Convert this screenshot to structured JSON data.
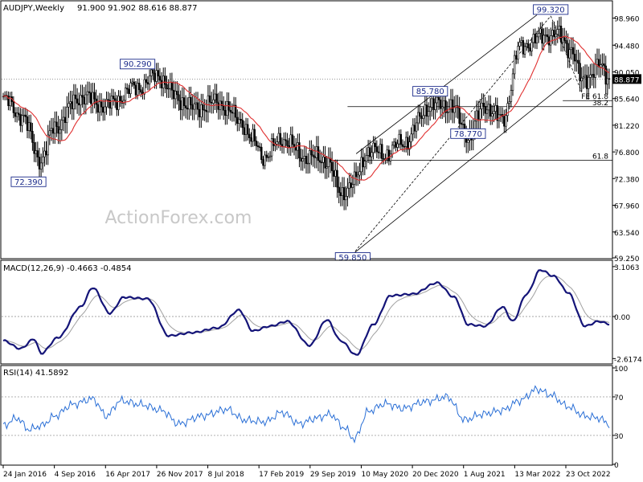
{
  "chart_data": [
    {
      "type": "candlestick",
      "title": "AUDJPY,Weekly",
      "ohlc_label": "91.900 91.902 88.616 88.877",
      "watermark": "ActionForex.com",
      "current_price": "88.877",
      "ylim": [
        59.25,
        101.7
      ],
      "y_ticks": [
        "98.960",
        "94.480",
        "90.050",
        "85.640",
        "81.220",
        "76.800",
        "72.380",
        "67.960",
        "63.540",
        "59.250"
      ],
      "x_ticks": [
        "24 Jan 2016",
        "4 Sep 2016",
        "16 Apr 2017",
        "26 Nov 2017",
        "8 Jul 2018",
        "17 Feb 2019",
        "29 Sep 2019",
        "10 May 2020",
        "20 Dec 2020",
        "1 Aug 2021",
        "13 Mar 2022",
        "23 Oct 2022"
      ],
      "anchors": [
        {
          "t": 0,
          "c": 85.5
        },
        {
          "t": 10,
          "c": 83.0
        },
        {
          "t": 22,
          "c": 75.5
        },
        {
          "t": 30,
          "c": 81.0
        },
        {
          "t": 45,
          "c": 86.0
        },
        {
          "t": 60,
          "c": 84.5
        },
        {
          "t": 78,
          "c": 87.5
        },
        {
          "t": 90,
          "c": 89.5
        },
        {
          "t": 100,
          "c": 86.0
        },
        {
          "t": 110,
          "c": 84.0
        },
        {
          "t": 125,
          "c": 85.0
        },
        {
          "t": 138,
          "c": 82.0
        },
        {
          "t": 145,
          "c": 78.5
        },
        {
          "t": 152,
          "c": 76.0
        },
        {
          "t": 162,
          "c": 79.0
        },
        {
          "t": 175,
          "c": 76.0
        },
        {
          "t": 188,
          "c": 75.5
        },
        {
          "t": 196,
          "c": 70.0
        },
        {
          "t": 203,
          "c": 71.5
        },
        {
          "t": 212,
          "c": 77.0
        },
        {
          "t": 222,
          "c": 76.5
        },
        {
          "t": 233,
          "c": 78.5
        },
        {
          "t": 248,
          "c": 84.5
        },
        {
          "t": 260,
          "c": 84.5
        },
        {
          "t": 270,
          "c": 79.5
        },
        {
          "t": 280,
          "c": 84.5
        },
        {
          "t": 290,
          "c": 82.0
        },
        {
          "t": 300,
          "c": 94.0
        },
        {
          "t": 310,
          "c": 95.5
        },
        {
          "t": 320,
          "c": 96.5
        },
        {
          "t": 330,
          "c": 94.0
        },
        {
          "t": 336,
          "c": 88.5
        },
        {
          "t": 346,
          "c": 91.0
        },
        {
          "t": 352,
          "c": 88.9
        }
      ],
      "swing_labels": [
        {
          "text": "90.290",
          "t": 78,
          "value": 90.29
        },
        {
          "text": "72.390",
          "t": 22,
          "value": 72.39
        },
        {
          "text": "59.850",
          "t": 203,
          "value": 59.85
        },
        {
          "text": "85.780",
          "t": 248,
          "value": 85.78
        },
        {
          "text": "78.770",
          "t": 270,
          "value": 78.77
        },
        {
          "text": "99.320",
          "t": 318,
          "value": 99.32
        }
      ],
      "levels": [
        {
          "label": "61.8",
          "value": 75.4,
          "t_start": 190
        },
        {
          "label": "38.2",
          "value": 84.3,
          "t_start": 200
        },
        {
          "label": "FE 61.8",
          "value": 85.3,
          "t_start": 325
        }
      ],
      "channel": {
        "upper": [
          {
            "t": 205,
            "v": 76.5
          },
          {
            "t": 310,
            "v": 99.5
          }
        ],
        "lower": [
          {
            "t": 203,
            "v": 59.85
          },
          {
            "t": 330,
            "v": 89.0
          }
        ],
        "dashed": [
          {
            "t": 203,
            "v": 59.85
          },
          {
            "t": 318,
            "v": 99.32
          }
        ],
        "pattern": [
          {
            "t": 318,
            "v": 99.32
          },
          {
            "t": 336,
            "v": 86.7
          }
        ]
      }
    },
    {
      "type": "line",
      "title": "MACD(12,26,9) -0.4663 -0.4854",
      "ylim": [
        -2.9,
        3.4
      ],
      "y_ticks": [
        {
          "label": "3.1063",
          "value": 3.1063
        },
        {
          "label": "0.00",
          "value": 0
        },
        {
          "label": "-2.6174",
          "value": -2.6174
        }
      ],
      "series": [
        {
          "values": [
            {
              "t": 0,
              "v": -1.5
            },
            {
              "t": 10,
              "v": -2.0
            },
            {
              "t": 18,
              "v": -1.4
            },
            {
              "t": 22,
              "v": -2.3
            },
            {
              "t": 32,
              "v": -1.3
            },
            {
              "t": 45,
              "v": 0.6
            },
            {
              "t": 52,
              "v": 1.8
            },
            {
              "t": 62,
              "v": 0.2
            },
            {
              "t": 70,
              "v": 1.2
            },
            {
              "t": 84,
              "v": 1.1
            },
            {
              "t": 96,
              "v": -1.2
            },
            {
              "t": 110,
              "v": -1.0
            },
            {
              "t": 125,
              "v": -0.7
            },
            {
              "t": 137,
              "v": 0.4
            },
            {
              "t": 145,
              "v": -0.9
            },
            {
              "t": 155,
              "v": -0.6
            },
            {
              "t": 165,
              "v": -0.3
            },
            {
              "t": 178,
              "v": -1.8
            },
            {
              "t": 188,
              "v": -0.2
            },
            {
              "t": 196,
              "v": -1.5
            },
            {
              "t": 205,
              "v": -2.4
            },
            {
              "t": 215,
              "v": -0.5
            },
            {
              "t": 225,
              "v": 1.3
            },
            {
              "t": 238,
              "v": 1.4
            },
            {
              "t": 252,
              "v": 2.1
            },
            {
              "t": 262,
              "v": 1.2
            },
            {
              "t": 270,
              "v": -0.5
            },
            {
              "t": 280,
              "v": -0.6
            },
            {
              "t": 290,
              "v": 0.6
            },
            {
              "t": 296,
              "v": -0.3
            },
            {
              "t": 304,
              "v": 1.4
            },
            {
              "t": 312,
              "v": 2.9
            },
            {
              "t": 320,
              "v": 2.5
            },
            {
              "t": 328,
              "v": 1.5
            },
            {
              "t": 338,
              "v": -0.6
            },
            {
              "t": 346,
              "v": -0.3
            },
            {
              "t": 352,
              "v": -0.47
            }
          ]
        }
      ]
    },
    {
      "type": "line",
      "title": "RSI(14) 41.5892",
      "ylim": [
        0,
        100
      ],
      "y_ticks": [
        {
          "label": "100",
          "value": 100
        },
        {
          "label": "70",
          "value": 70
        },
        {
          "label": "30",
          "value": 30
        },
        {
          "label": "0",
          "value": 0
        }
      ],
      "series": [
        {
          "values": [
            {
              "t": 0,
              "v": 40
            },
            {
              "t": 8,
              "v": 48
            },
            {
              "t": 15,
              "v": 36
            },
            {
              "t": 22,
              "v": 40
            },
            {
              "t": 30,
              "v": 50
            },
            {
              "t": 40,
              "v": 62
            },
            {
              "t": 52,
              "v": 68
            },
            {
              "t": 60,
              "v": 50
            },
            {
              "t": 68,
              "v": 66
            },
            {
              "t": 80,
              "v": 62
            },
            {
              "t": 92,
              "v": 56
            },
            {
              "t": 102,
              "v": 42
            },
            {
              "t": 115,
              "v": 50
            },
            {
              "t": 130,
              "v": 57
            },
            {
              "t": 140,
              "v": 46
            },
            {
              "t": 152,
              "v": 44
            },
            {
              "t": 162,
              "v": 54
            },
            {
              "t": 172,
              "v": 42
            },
            {
              "t": 182,
              "v": 48
            },
            {
              "t": 190,
              "v": 52
            },
            {
              "t": 198,
              "v": 38
            },
            {
              "t": 204,
              "v": 26
            },
            {
              "t": 212,
              "v": 55
            },
            {
              "t": 222,
              "v": 63
            },
            {
              "t": 232,
              "v": 58
            },
            {
              "t": 245,
              "v": 65
            },
            {
              "t": 258,
              "v": 70
            },
            {
              "t": 268,
              "v": 46
            },
            {
              "t": 278,
              "v": 52
            },
            {
              "t": 290,
              "v": 56
            },
            {
              "t": 300,
              "v": 66
            },
            {
              "t": 310,
              "v": 78
            },
            {
              "t": 318,
              "v": 72
            },
            {
              "t": 328,
              "v": 60
            },
            {
              "t": 338,
              "v": 50
            },
            {
              "t": 346,
              "v": 48
            },
            {
              "t": 352,
              "v": 41.6
            }
          ]
        }
      ]
    }
  ]
}
